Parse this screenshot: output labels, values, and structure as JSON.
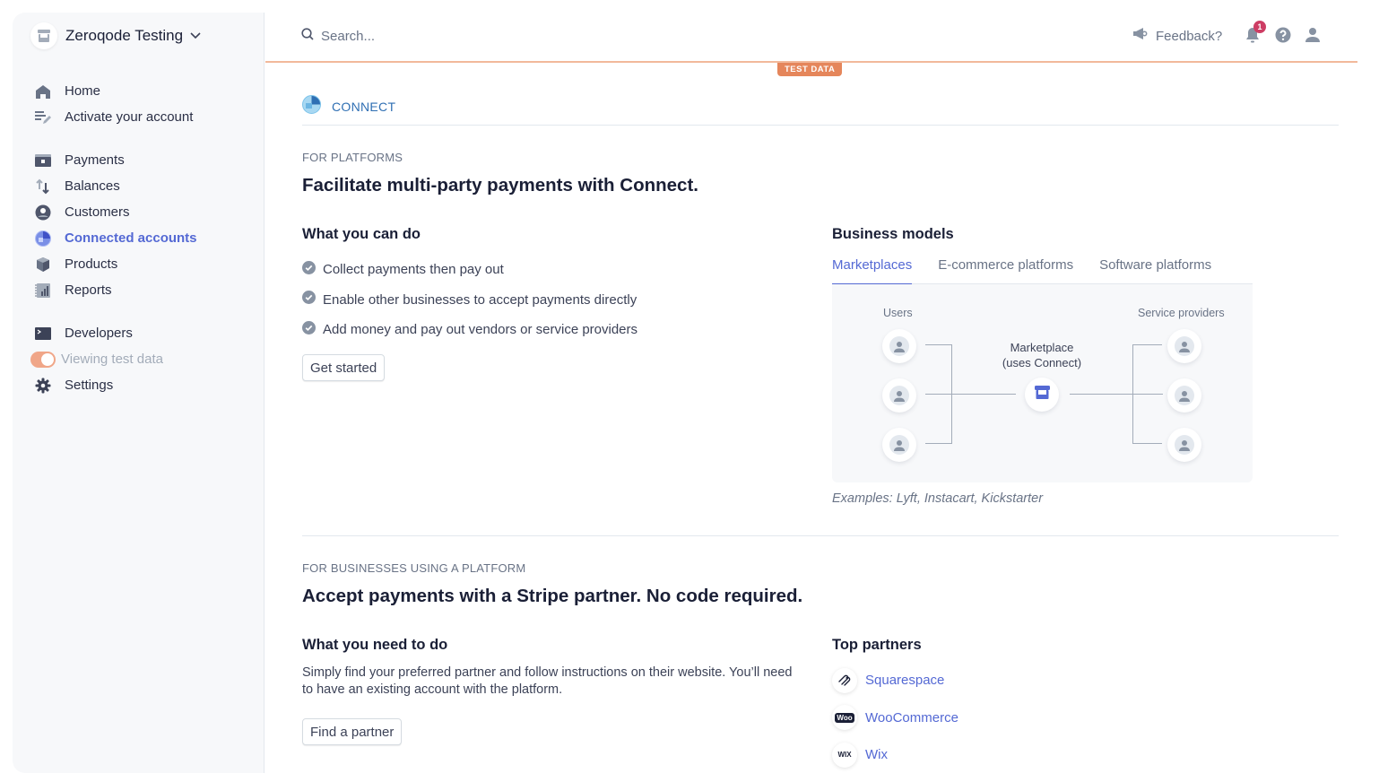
{
  "account": {
    "name": "Zeroqode Testing"
  },
  "sidebar": {
    "groups": [
      [
        {
          "label": "Home",
          "icon": "home-icon"
        },
        {
          "label": "Activate your account",
          "icon": "activate-icon"
        }
      ],
      [
        {
          "label": "Payments",
          "icon": "payments-icon"
        },
        {
          "label": "Balances",
          "icon": "balances-icon"
        },
        {
          "label": "Customers",
          "icon": "customers-icon"
        },
        {
          "label": "Connected accounts",
          "icon": "connect-icon",
          "active": true
        },
        {
          "label": "Products",
          "icon": "products-icon"
        },
        {
          "label": "Reports",
          "icon": "reports-icon"
        }
      ],
      [
        {
          "label": "Developers",
          "icon": "terminal-icon"
        },
        {
          "label": "Viewing test data",
          "icon": "toggle",
          "toggle_on": true
        },
        {
          "label": "Settings",
          "icon": "gear-icon"
        }
      ]
    ]
  },
  "topbar": {
    "search_placeholder": "Search...",
    "feedback_label": "Feedback?",
    "notification_count": "1",
    "test_data_label": "TEST DATA"
  },
  "colors": {
    "accent": "#5469d4",
    "test_mode": "#e5865b",
    "badge": "#cd3d64"
  },
  "page": {
    "breadcrumb": "CONNECT",
    "platforms": {
      "eyebrow": "FOR PLATFORMS",
      "title": "Facilitate multi-party payments with Connect.",
      "can_do_title": "What you can do",
      "can_do_items": [
        "Collect payments then pay out",
        "Enable other businesses to accept payments directly",
        "Add money and pay out vendors or service providers"
      ],
      "get_started_label": "Get started",
      "business_models_title": "Business models",
      "tabs": [
        {
          "label": "Marketplaces",
          "active": true
        },
        {
          "label": "E-commerce platforms",
          "active": false
        },
        {
          "label": "Software platforms",
          "active": false
        }
      ],
      "diagram": {
        "left_label": "Users",
        "right_label": "Service providers",
        "center_label_line1": "Marketplace",
        "center_label_line2": "(uses Connect)"
      },
      "examples": "Examples: Lyft, Instacart, Kickstarter"
    },
    "businesses": {
      "eyebrow": "FOR BUSINESSES USING A PLATFORM",
      "title": "Accept payments with a Stripe partner. No code required.",
      "need_title": "What you need to do",
      "need_desc": "Simply find your preferred partner and follow instructions on their website. You’ll need to have an existing account with the platform.",
      "find_partner_label": "Find a partner",
      "partners_title": "Top partners",
      "partners": [
        {
          "name": "Squarespace",
          "logo": "squarespace-logo"
        },
        {
          "name": "WooCommerce",
          "logo": "woo-logo",
          "logo_text": "Woo"
        },
        {
          "name": "Wix",
          "logo": "wix-logo",
          "logo_text": "WIX"
        }
      ]
    }
  }
}
